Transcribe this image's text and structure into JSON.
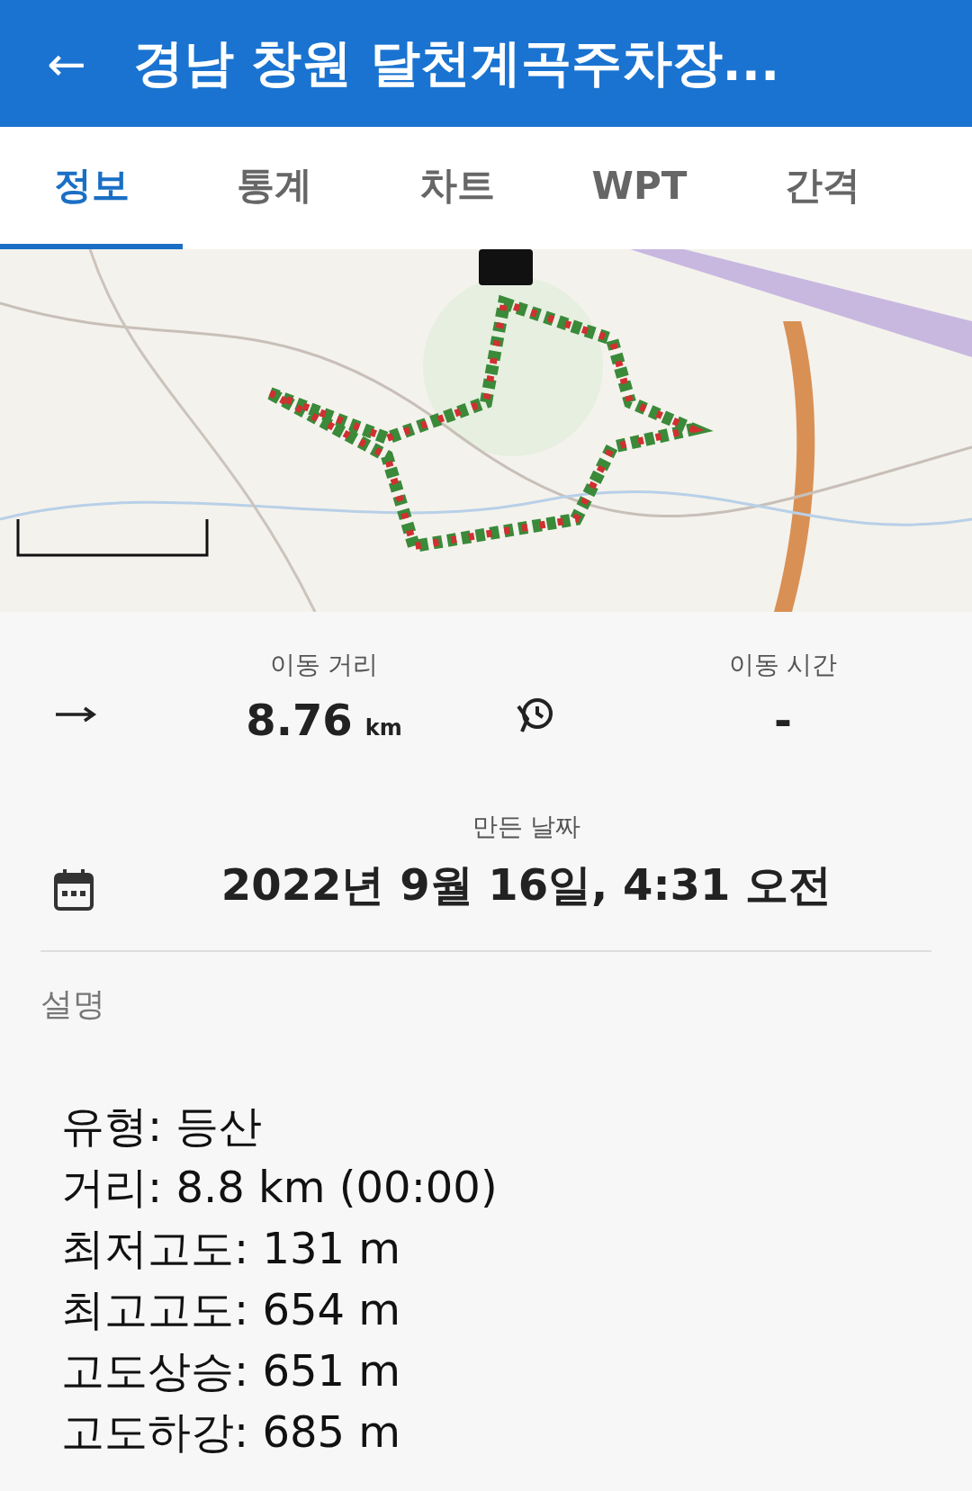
{
  "header": {
    "back": "←",
    "title": "경남 창원 달천계곡주차장..."
  },
  "tabs": [
    {
      "label": "정보",
      "selected": true
    },
    {
      "label": "통계",
      "selected": false
    },
    {
      "label": "차트",
      "selected": false
    },
    {
      "label": "WPT",
      "selected": false
    },
    {
      "label": "간격",
      "selected": false
    }
  ],
  "stats": [
    {
      "label": "이동 거리",
      "value": "8.76",
      "unit": "km"
    },
    {
      "label": "이동 시간",
      "value": "-"
    }
  ],
  "created": {
    "label": "만든 날짜",
    "value": "2022년 9월 16일, 4:31 오전"
  },
  "description": {
    "heading": "설명",
    "lines": [
      "유형: 등산",
      "거리: 8.8 km (00:00)",
      "최저고도: 131 m",
      "최고고도: 654 m",
      "고도상승: 651 m",
      "고도하강: 685 m"
    ]
  }
}
